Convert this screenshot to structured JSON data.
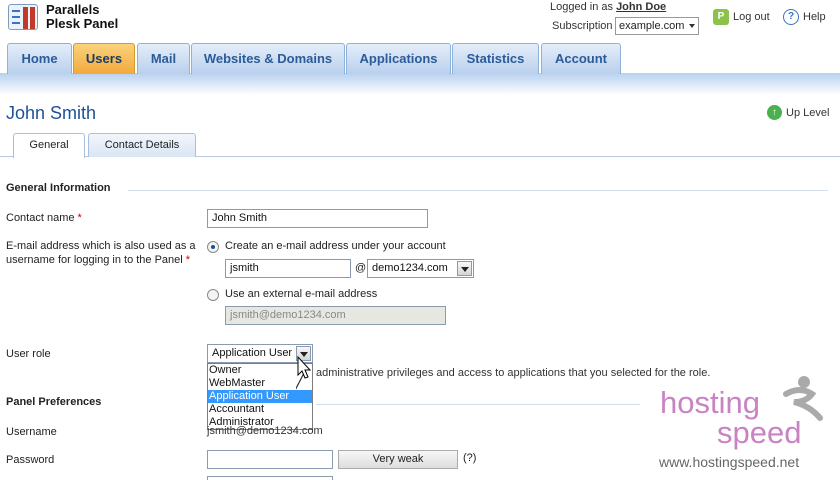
{
  "header": {
    "logo_line1": "Parallels",
    "logo_line2": "Plesk Panel",
    "logged_in_label": "Logged in as",
    "logged_in_user": "John Doe",
    "subscription_label": "Subscription",
    "subscription_value": "example.com",
    "logout_label": "Log out",
    "help_label": "Help"
  },
  "nav": {
    "tabs": [
      "Home",
      "Users",
      "Mail",
      "Websites & Domains",
      "Applications",
      "Statistics",
      "Account"
    ],
    "active": "Users"
  },
  "page": {
    "title": "John Smith",
    "up_level": "Up Level",
    "subtabs": [
      "General",
      "Contact Details"
    ]
  },
  "form": {
    "general_info": "General Information",
    "contact_name_label": "Contact name",
    "contact_name_value": "John Smith",
    "email_label_1": "E-mail address which is also used as a",
    "email_label_2": "username for logging in to the Panel",
    "create_email_option": "Create an e-mail address under your account",
    "email_local": "jsmith",
    "at_sign": "@",
    "email_domain": "demo1234.com",
    "external_email_option": "Use an external e-mail address",
    "external_email_value": "jsmith@demo1234.com",
    "user_role_label": "User role",
    "user_role_value": "Application User",
    "user_role_options": [
      "Owner",
      "WebMaster",
      "Application User",
      "Accountant",
      "Administrator"
    ],
    "role_hint": "administrative privileges and access to applications that you selected for the role.",
    "panel_prefs": "Panel Preferences",
    "username_label": "Username",
    "username_value": "jsmith@demo1234.com",
    "password_label": "Password",
    "password_strength": "Very weak",
    "password_help": "(?)"
  },
  "watermark": {
    "brand1": "hosting",
    "brand2": "speed",
    "url": "www.hostingspeed.net"
  },
  "colors": {
    "nav_active": "#f3a93a",
    "title": "#1f4f98",
    "selected_option": "#3399ff",
    "watermark": "#c983c2"
  }
}
